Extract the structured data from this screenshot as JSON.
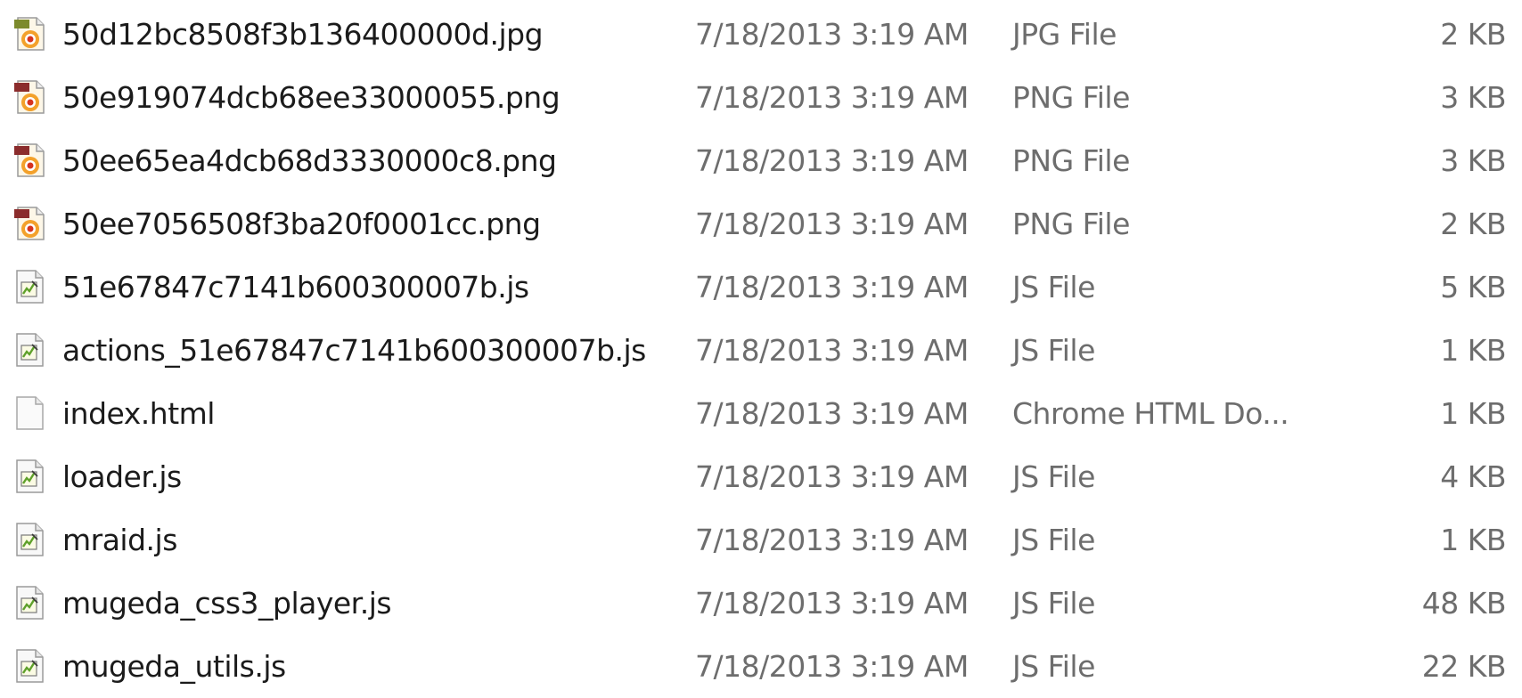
{
  "files": [
    {
      "name": "50d12bc8508f3b136400000d.jpg",
      "date": "7/18/2013 3:19 AM",
      "type": "JPG File",
      "size": "2 KB",
      "icon": "jpg-file-icon"
    },
    {
      "name": "50e919074dcb68ee33000055.png",
      "date": "7/18/2013 3:19 AM",
      "type": "PNG File",
      "size": "3 KB",
      "icon": "png-file-icon"
    },
    {
      "name": "50ee65ea4dcb68d3330000c8.png",
      "date": "7/18/2013 3:19 AM",
      "type": "PNG File",
      "size": "3 KB",
      "icon": "png-file-icon"
    },
    {
      "name": "50ee7056508f3ba20f0001cc.png",
      "date": "7/18/2013 3:19 AM",
      "type": "PNG File",
      "size": "2 KB",
      "icon": "png-file-icon"
    },
    {
      "name": "51e67847c7141b600300007b.js",
      "date": "7/18/2013 3:19 AM",
      "type": "JS File",
      "size": "5 KB",
      "icon": "js-file-icon"
    },
    {
      "name": "actions_51e67847c7141b600300007b.js",
      "date": "7/18/2013 3:19 AM",
      "type": "JS File",
      "size": "1 KB",
      "icon": "js-file-icon"
    },
    {
      "name": "index.html",
      "date": "7/18/2013 3:19 AM",
      "type": "Chrome HTML Do...",
      "size": "1 KB",
      "icon": "html-file-icon"
    },
    {
      "name": "loader.js",
      "date": "7/18/2013 3:19 AM",
      "type": "JS File",
      "size": "4 KB",
      "icon": "js-file-icon"
    },
    {
      "name": "mraid.js",
      "date": "7/18/2013 3:19 AM",
      "type": "JS File",
      "size": "1 KB",
      "icon": "js-file-icon"
    },
    {
      "name": "mugeda_css3_player.js",
      "date": "7/18/2013 3:19 AM",
      "type": "JS File",
      "size": "48 KB",
      "icon": "js-file-icon"
    },
    {
      "name": "mugeda_utils.js",
      "date": "7/18/2013 3:19 AM",
      "type": "JS File",
      "size": "22 KB",
      "icon": "js-file-icon"
    }
  ]
}
